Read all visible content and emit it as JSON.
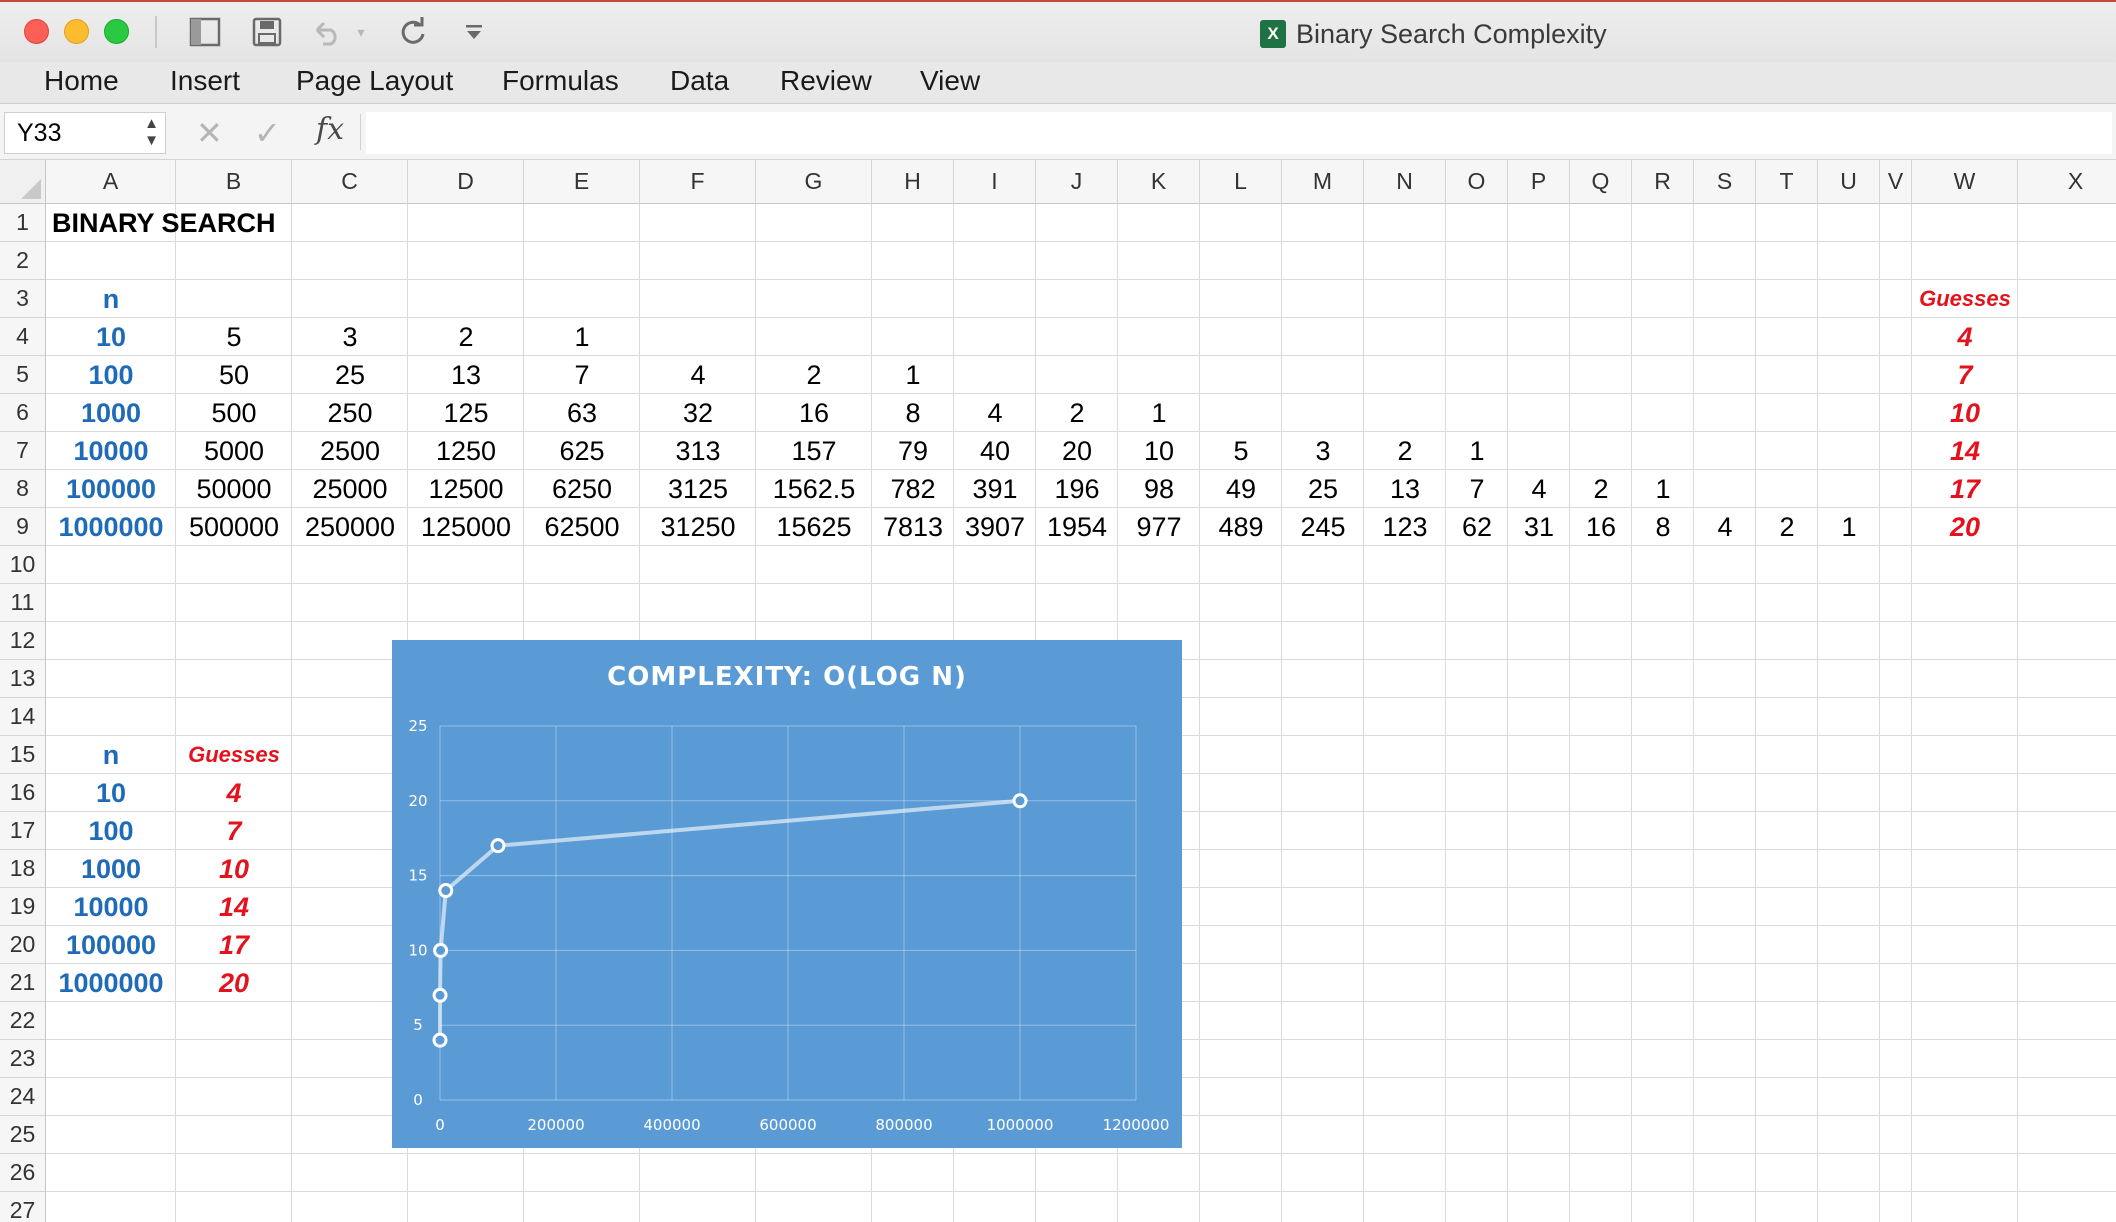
{
  "window": {
    "title": "Binary Search Complexity",
    "app_icon": "excel-icon",
    "qa_icons": [
      "sidebar-toggle-icon",
      "save-icon",
      "undo-icon",
      "undo-dropdown-icon",
      "redo-icon",
      "customize-toolbar-icon"
    ]
  },
  "ribbon": {
    "tabs": [
      "Home",
      "Insert",
      "Page Layout",
      "Formulas",
      "Data",
      "Review",
      "View"
    ]
  },
  "formula_bar": {
    "name_box": "Y33",
    "cancel_icon": "✕",
    "enter_icon": "✓",
    "fx_label": "fx",
    "formula": ""
  },
  "sheet": {
    "columns": [
      "A",
      "B",
      "C",
      "D",
      "E",
      "F",
      "G",
      "H",
      "I",
      "J",
      "K",
      "L",
      "M",
      "N",
      "O",
      "P",
      "Q",
      "R",
      "S",
      "T",
      "U",
      "V",
      "W",
      "X"
    ],
    "rows": [
      "1",
      "2",
      "3",
      "4",
      "5",
      "6",
      "7",
      "8",
      "9",
      "10",
      "11",
      "12",
      "13",
      "14",
      "15",
      "16",
      "17",
      "18",
      "19",
      "20",
      "21",
      "22",
      "23",
      "24",
      "25",
      "26",
      "27"
    ],
    "title": "BINARY SEARCH",
    "table1": {
      "n_header": "n",
      "guesses_header": "Guesses",
      "rows": [
        {
          "n": "10",
          "steps": [
            "5",
            "3",
            "2",
            "1"
          ],
          "guesses": "4"
        },
        {
          "n": "100",
          "steps": [
            "50",
            "25",
            "13",
            "7",
            "4",
            "2",
            "1"
          ],
          "guesses": "7"
        },
        {
          "n": "1000",
          "steps": [
            "500",
            "250",
            "125",
            "63",
            "32",
            "16",
            "8",
            "4",
            "2",
            "1"
          ],
          "guesses": "10"
        },
        {
          "n": "10000",
          "steps": [
            "5000",
            "2500",
            "1250",
            "625",
            "313",
            "157",
            "79",
            "40",
            "20",
            "10",
            "5",
            "3",
            "2",
            "1"
          ],
          "guesses": "14"
        },
        {
          "n": "100000",
          "steps": [
            "50000",
            "25000",
            "12500",
            "6250",
            "3125",
            "1562.5",
            "782",
            "391",
            "196",
            "98",
            "49",
            "25",
            "13",
            "7",
            "4",
            "2",
            "1"
          ],
          "guesses": "17"
        },
        {
          "n": "1000000",
          "steps": [
            "500000",
            "250000",
            "125000",
            "62500",
            "31250",
            "15625",
            "7813",
            "3907",
            "1954",
            "977",
            "489",
            "245",
            "123",
            "62",
            "31",
            "16",
            "8",
            "4",
            "2",
            "1"
          ],
          "guesses": "20"
        }
      ]
    },
    "table2": {
      "n_header": "n",
      "guesses_header": "Guesses",
      "rows": [
        {
          "n": "10",
          "guesses": "4"
        },
        {
          "n": "100",
          "guesses": "7"
        },
        {
          "n": "1000",
          "guesses": "10"
        },
        {
          "n": "10000",
          "guesses": "14"
        },
        {
          "n": "100000",
          "guesses": "17"
        },
        {
          "n": "1000000",
          "guesses": "20"
        }
      ]
    }
  },
  "colors": {
    "blue_text": "#1f6bb8",
    "red_text": "#e3121d",
    "chart_bg": "#5b9bd5"
  },
  "chart_data": {
    "type": "scatter",
    "title": "COMPLEXITY:  O(LOG N)",
    "x": [
      10,
      100,
      1000,
      10000,
      100000,
      1000000
    ],
    "y": [
      4,
      7,
      10,
      14,
      17,
      20
    ],
    "xlim": [
      0,
      1200000
    ],
    "ylim": [
      0,
      25
    ],
    "xticks": [
      "0",
      "200000",
      "400000",
      "600000",
      "800000",
      "1000000",
      "1200000"
    ],
    "yticks": [
      "0",
      "5",
      "10",
      "15",
      "20",
      "25"
    ],
    "xlabel": "",
    "ylabel": "",
    "grid": true,
    "markers": "hollow circles connected by line"
  }
}
